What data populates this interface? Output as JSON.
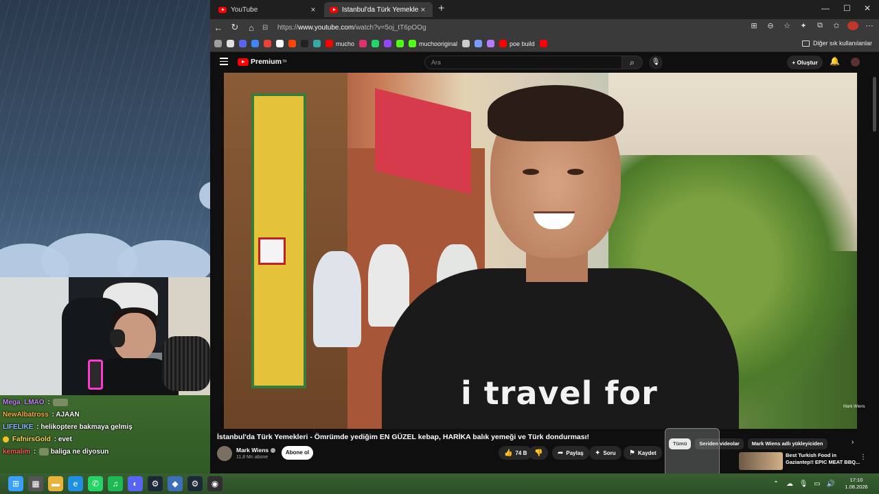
{
  "chat": [
    {
      "user": "Mega_LMAO",
      "color": "#c77dff",
      "sep": ":",
      "message": "",
      "emote": true,
      "badge": false
    },
    {
      "user": "NewAlbatross",
      "color": "#ffb13b",
      "sep": ":",
      "message": "AJAAN",
      "emote": false,
      "badge": false
    },
    {
      "user": "LIFELIKE",
      "color": "#8fb7ff",
      "sep": ":",
      "message": "helikoptere bakmaya gelmiş",
      "emote": false,
      "badge": false
    },
    {
      "user": "FafnirsGold",
      "color": "#ffd84d",
      "sep": ":",
      "message": "evet",
      "emote": false,
      "badge": true
    },
    {
      "user": "kemalim",
      "color": "#ff5a5a",
      "sep": ":",
      "message": "baliga ne diyosun",
      "emote": true,
      "badge": false
    }
  ],
  "browser": {
    "tabs": [
      {
        "label": "YouTube"
      },
      {
        "label": "İstanbul'da Türk Yemekleri - Ömrü"
      }
    ],
    "new_tab": "+",
    "window_controls": {
      "minimize": "—",
      "maximize": "☐",
      "close": "✕"
    },
    "url_prefix": "https://",
    "url_host": "www.youtube.com",
    "url_path": "/watch?v=5oj_tT6pOOg",
    "bookmarks": [
      {
        "label": "",
        "color": "#9e9e9e"
      },
      {
        "label": "",
        "color": "#e0e0e0"
      },
      {
        "label": "",
        "color": "#5865f2"
      },
      {
        "label": "",
        "color": "#4285f4"
      },
      {
        "label": "",
        "color": "#ea4335"
      },
      {
        "label": "",
        "color": "#ffffff"
      },
      {
        "label": "",
        "color": "#ff4500"
      },
      {
        "label": "",
        "color": "#222222"
      },
      {
        "label": "",
        "color": "#3aa7a7"
      },
      {
        "label": "mucho",
        "color": "#ff0000"
      },
      {
        "label": "",
        "color": "#e1306c"
      },
      {
        "label": "",
        "color": "#25d366"
      },
      {
        "label": "",
        "color": "#9146ff"
      },
      {
        "label": "",
        "color": "#53fc18"
      },
      {
        "label": "muchooriginal",
        "color": "#53fc18"
      },
      {
        "label": "",
        "color": "#cccccc"
      },
      {
        "label": "",
        "color": "#7b9cff"
      },
      {
        "label": "",
        "color": "#b57bff"
      },
      {
        "label": "poe build",
        "color": "#ff0000"
      },
      {
        "label": "",
        "color": "#ff0000"
      }
    ],
    "other_bookmarks": "Diğer sık kullanılanlar"
  },
  "youtube": {
    "brand": "Premium",
    "brand_sup": "TR",
    "search_placeholder": "Ara",
    "create_label": "Oluştur",
    "video": {
      "shirt_text": "i travel for",
      "watermark": "Mark Wiens",
      "title": "İstanbul'da Türk Yemekleri - Ömrümde yediğim EN GÜZEL kebap, HARİKA balık yemeği ve Türk dondurması!"
    },
    "channel": {
      "name": "Mark Wiens",
      "subs": "11,8 Mn abone",
      "subscribe": "Abone ol"
    },
    "actions": {
      "likes": "74 B",
      "share": "Paylaş",
      "ask": "Soru",
      "save": "Kaydet"
    },
    "chips": [
      "Tümü",
      "Seriden videolar",
      "Mark Wiens adlı yükleyiciden"
    ],
    "recommendation": {
      "title": "Best Turkish Food in Gaziantep!! EPIC MEAT BBQ..."
    }
  },
  "taskbar": {
    "apps": [
      {
        "name": "windows-start-icon",
        "color": "#3aa0ff",
        "glyph": "⊞"
      },
      {
        "name": "task-view-icon",
        "color": "#555",
        "glyph": "▦"
      },
      {
        "name": "file-explorer-icon",
        "color": "#e8b33a",
        "glyph": "▬"
      },
      {
        "name": "edge-icon",
        "color": "#1e8fe1",
        "glyph": "e"
      },
      {
        "name": "whatsapp-icon",
        "color": "#25d366",
        "glyph": "✆"
      },
      {
        "name": "spotify-icon",
        "color": "#1db954",
        "glyph": "♫"
      },
      {
        "name": "discord-icon",
        "color": "#5865f2",
        "glyph": "◐"
      },
      {
        "name": "steam-icon",
        "color": "#1b2838",
        "glyph": "⚙"
      },
      {
        "name": "app-icon",
        "color": "#3d6fb6",
        "glyph": "◆"
      },
      {
        "name": "steam-icon-2",
        "color": "#1b2838",
        "glyph": "⚙"
      },
      {
        "name": "obs-icon",
        "color": "#302e31",
        "glyph": "◉"
      }
    ],
    "time": "17:10",
    "date": "1.08.2026"
  },
  "colors": {
    "accent": "#ff0000",
    "yt_bg": "#0f0f0f"
  }
}
